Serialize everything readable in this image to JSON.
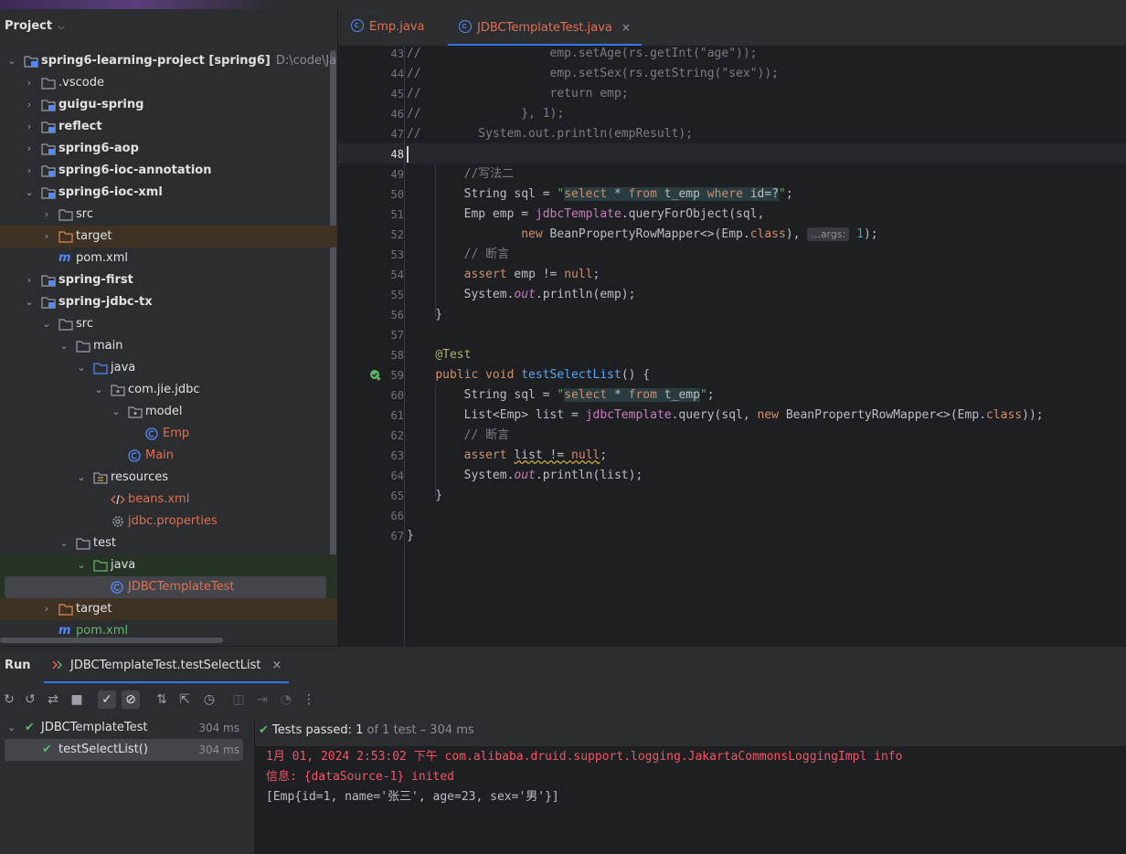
{
  "project_panel": {
    "title": "Project",
    "rows": [
      {
        "label": "spring6-learning-project",
        "suffix": "[spring6]",
        "path": "D:\\code\\Java\\spr"
      },
      {
        "label": ".vscode"
      },
      {
        "label": "guigu-spring"
      },
      {
        "label": "reflect"
      },
      {
        "label": "spring6-aop"
      },
      {
        "label": "spring6-ioc-annotation"
      },
      {
        "label": "spring6-ioc-xml"
      },
      {
        "label": "src"
      },
      {
        "label": "target"
      },
      {
        "label": "pom.xml"
      },
      {
        "label": "spring-first"
      },
      {
        "label": "spring-jdbc-tx"
      },
      {
        "label": "src"
      },
      {
        "label": "main"
      },
      {
        "label": "java"
      },
      {
        "label": "com.jie.jdbc"
      },
      {
        "label": "model"
      },
      {
        "label": "Emp"
      },
      {
        "label": "Main"
      },
      {
        "label": "resources"
      },
      {
        "label": "beans.xml"
      },
      {
        "label": "jdbc.properties"
      },
      {
        "label": "test"
      },
      {
        "label": "java"
      },
      {
        "label": "JDBCTemplateTest"
      },
      {
        "label": "target"
      },
      {
        "label": "pom.xml"
      }
    ]
  },
  "tabs": [
    {
      "label": "Emp.java"
    },
    {
      "label": "JDBCTemplateTest.java",
      "close": "×"
    }
  ],
  "editor": {
    "line_numbers": [
      "43",
      "44",
      "45",
      "46",
      "47",
      "48",
      "49",
      "50",
      "51",
      "52",
      "53",
      "54",
      "55",
      "56",
      "57",
      "58",
      "59",
      "60",
      "61",
      "62",
      "63",
      "64",
      "65",
      "66",
      "67"
    ]
  },
  "run_panel": {
    "title": "Run",
    "tab_label": "JDBCTemplateTest.testSelectList",
    "tab_close": "×",
    "tree": [
      {
        "label": "JDBCTemplateTest",
        "time": "304 ms"
      },
      {
        "label": "testSelectList()",
        "time": "304 ms"
      }
    ],
    "status_prefix": "Tests passed:",
    "status_count": "1",
    "status_rest": "of 1 test – 304 ms",
    "console": [
      "1月 01, 2024 2:53:02 下午 com.alibaba.druid.support.logging.JakartaCommonsLoggingImpl info",
      "信息: {dataSource-1} inited",
      "[Emp{id=1, name='张三', age=23, sex='男'}]"
    ]
  },
  "colors": {
    "accent": "#3574f0",
    "pass": "#5fb865",
    "error": "#f75464"
  }
}
